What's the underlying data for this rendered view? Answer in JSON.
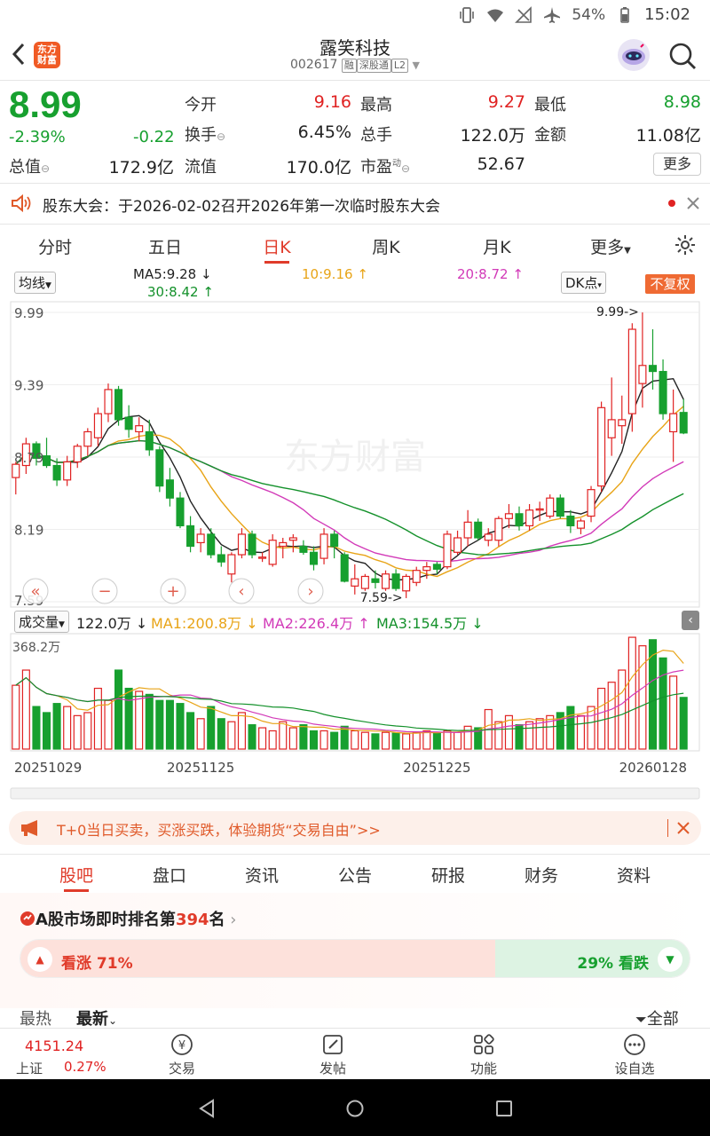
{
  "status": {
    "battery": "54%",
    "time": "15:02"
  },
  "header": {
    "title": "露笑科技",
    "code": "002617",
    "tags": [
      "融",
      "深股通",
      "L2"
    ],
    "logo_text": "东方财富"
  },
  "quote": {
    "price": "8.99",
    "pct": "-2.39%",
    "change": "-0.22",
    "fields": [
      {
        "label": "今开",
        "value": "9.16",
        "color": "red"
      },
      {
        "label": "最高",
        "value": "9.27",
        "color": "red"
      },
      {
        "label": "最低",
        "value": "8.98",
        "color": "green"
      },
      {
        "label": "换手",
        "value": "6.45%",
        "color": "dark"
      },
      {
        "label": "总手",
        "value": "122.0万",
        "color": "dark"
      },
      {
        "label": "金额",
        "value": "11.08亿",
        "color": "dark"
      },
      {
        "label": "总值",
        "value": "172.9亿",
        "color": "dark"
      },
      {
        "label": "流值",
        "value": "170.0亿",
        "color": "dark"
      },
      {
        "label": "市盈",
        "value": "52.67",
        "color": "dark"
      }
    ],
    "more_label": "更多",
    "pe_sup": "动"
  },
  "notice": {
    "text": "股东大会：于2026-02-02召开2026年第一次临时股东大会"
  },
  "period_tabs": [
    "分时",
    "五日",
    "日K",
    "周K",
    "月K",
    "更多"
  ],
  "ma_row": {
    "selector": "均线",
    "ma5": "MA5:9.28",
    "ma10": "10:9.16",
    "ma20": "20:8.72",
    "ma30": "30:8.42",
    "dk": "DK点",
    "fq": "不复权"
  },
  "chart_data": {
    "type": "candlestick",
    "price_axis_labels": [
      "9.99",
      "9.39",
      "8.79",
      "8.19",
      "7.59"
    ],
    "high_marker": "9.99->",
    "low_marker": "7.59->",
    "watermark": "东方财富",
    "date_labels": [
      "20251029",
      "20251125",
      "20251225",
      "20260128"
    ],
    "ylim": [
      7.59,
      9.99
    ],
    "candles": [
      [
        8.62,
        8.75,
        8.48,
        8.73
      ],
      [
        8.72,
        8.95,
        8.65,
        8.9
      ],
      [
        8.9,
        8.92,
        8.72,
        8.78
      ],
      [
        8.8,
        8.95,
        8.7,
        8.72
      ],
      [
        8.72,
        8.78,
        8.55,
        8.6
      ],
      [
        8.6,
        8.8,
        8.55,
        8.75
      ],
      [
        8.75,
        8.9,
        8.7,
        8.88
      ],
      [
        8.88,
        9.03,
        8.8,
        9.0
      ],
      [
        8.95,
        9.2,
        8.88,
        9.15
      ],
      [
        9.15,
        9.4,
        9.08,
        9.35
      ],
      [
        9.35,
        9.38,
        9.05,
        9.1
      ],
      [
        9.12,
        9.22,
        8.95,
        9.02
      ],
      [
        9.0,
        9.12,
        8.92,
        9.05
      ],
      [
        9.0,
        9.1,
        8.8,
        8.85
      ],
      [
        8.85,
        8.88,
        8.5,
        8.55
      ],
      [
        8.6,
        8.7,
        8.38,
        8.45
      ],
      [
        8.45,
        8.5,
        8.2,
        8.22
      ],
      [
        8.22,
        8.3,
        8.0,
        8.05
      ],
      [
        8.08,
        8.2,
        8.0,
        8.15
      ],
      [
        8.15,
        8.2,
        7.95,
        7.98
      ],
      [
        7.98,
        8.05,
        7.88,
        7.92
      ],
      [
        7.82,
        8.0,
        7.75,
        7.98
      ],
      [
        7.98,
        8.2,
        7.95,
        8.15
      ],
      [
        8.15,
        8.18,
        7.95,
        7.98
      ],
      [
        7.95,
        8.0,
        7.92,
        7.96
      ],
      [
        7.9,
        8.15,
        7.88,
        8.1
      ],
      [
        8.05,
        8.12,
        7.95,
        8.08
      ],
      [
        8.1,
        8.15,
        8.0,
        8.12
      ],
      [
        8.05,
        8.1,
        7.98,
        8.0
      ],
      [
        8.0,
        8.05,
        7.85,
        7.9
      ],
      [
        7.95,
        8.2,
        7.9,
        8.15
      ],
      [
        8.15,
        8.18,
        7.95,
        8.05
      ],
      [
        7.98,
        8.0,
        7.75,
        7.76
      ],
      [
        7.72,
        7.9,
        7.65,
        7.78
      ],
      [
        7.7,
        7.82,
        7.68,
        7.8
      ],
      [
        7.78,
        7.85,
        7.7,
        7.75
      ],
      [
        7.7,
        7.85,
        7.68,
        7.82
      ],
      [
        7.82,
        7.86,
        7.68,
        7.7
      ],
      [
        7.68,
        7.82,
        7.62,
        7.8
      ],
      [
        7.75,
        7.88,
        7.72,
        7.85
      ],
      [
        7.85,
        7.92,
        7.78,
        7.88
      ],
      [
        7.9,
        7.92,
        7.82,
        7.86
      ],
      [
        7.88,
        8.18,
        7.86,
        8.15
      ],
      [
        8.0,
        8.18,
        7.98,
        8.12
      ],
      [
        8.12,
        8.35,
        8.05,
        8.25
      ],
      [
        8.25,
        8.28,
        8.1,
        8.12
      ],
      [
        8.1,
        8.2,
        8.05,
        8.15
      ],
      [
        8.1,
        8.3,
        8.05,
        8.28
      ],
      [
        8.28,
        8.4,
        8.2,
        8.32
      ],
      [
        8.32,
        8.38,
        8.18,
        8.22
      ],
      [
        8.22,
        8.4,
        8.18,
        8.35
      ],
      [
        8.35,
        8.42,
        8.26,
        8.36
      ],
      [
        8.3,
        8.48,
        8.28,
        8.45
      ],
      [
        8.45,
        8.48,
        8.28,
        8.3
      ],
      [
        8.3,
        8.35,
        8.16,
        8.22
      ],
      [
        8.2,
        8.28,
        8.15,
        8.26
      ],
      [
        8.3,
        8.55,
        8.25,
        8.52
      ],
      [
        8.55,
        9.25,
        8.5,
        9.2
      ],
      [
        8.95,
        9.45,
        8.8,
        9.1
      ],
      [
        9.05,
        9.3,
        8.9,
        9.1
      ],
      [
        9.15,
        9.9,
        9.0,
        9.85
      ],
      [
        9.4,
        9.99,
        9.2,
        9.55
      ],
      [
        9.55,
        9.85,
        9.35,
        9.5
      ],
      [
        9.5,
        9.6,
        9.1,
        9.15
      ],
      [
        9.0,
        9.35,
        8.75,
        9.15
      ],
      [
        9.16,
        9.27,
        8.98,
        8.99
      ]
    ],
    "vol_row": {
      "label": "成交量",
      "current": "122.0万",
      "ma1": "MA1:200.8万",
      "ma2": "MA2:226.4万",
      "ma3": "MA3:154.5万",
      "max_label": "368.2万"
    },
    "volumes": [
      210,
      260,
      140,
      120,
      150,
      140,
      110,
      120,
      200,
      160,
      260,
      200,
      190,
      180,
      160,
      160,
      150,
      120,
      100,
      140,
      100,
      90,
      120,
      80,
      70,
      60,
      90,
      70,
      80,
      60,
      60,
      55,
      75,
      60,
      55,
      50,
      55,
      52,
      50,
      55,
      60,
      52,
      60,
      55,
      75,
      70,
      130,
      90,
      110,
      80,
      90,
      100,
      110,
      120,
      140,
      110,
      140,
      200,
      220,
      260,
      368,
      340,
      360,
      300,
      240,
      170
    ]
  },
  "promo": {
    "text": "T+0当日买卖，买涨买跌，体验期货“交易自由”>>"
  },
  "content_tabs": [
    "股吧",
    "盘口",
    "资讯",
    "公告",
    "研报",
    "财务",
    "资料"
  ],
  "rank": {
    "prefix": "A股市场即时排名第",
    "number": "394",
    "suffix": "名",
    "up_label": "看涨 71%",
    "down_label": "29% 看跌",
    "up_pct": 71
  },
  "hot_row": {
    "hot": "最热",
    "new": "最新",
    "all": "全部"
  },
  "bottom_nav": {
    "index_value": "4151.24",
    "index_name": "上证",
    "index_pct": "0.27%",
    "items": [
      "交易",
      "发帖",
      "功能",
      "设自选"
    ]
  }
}
